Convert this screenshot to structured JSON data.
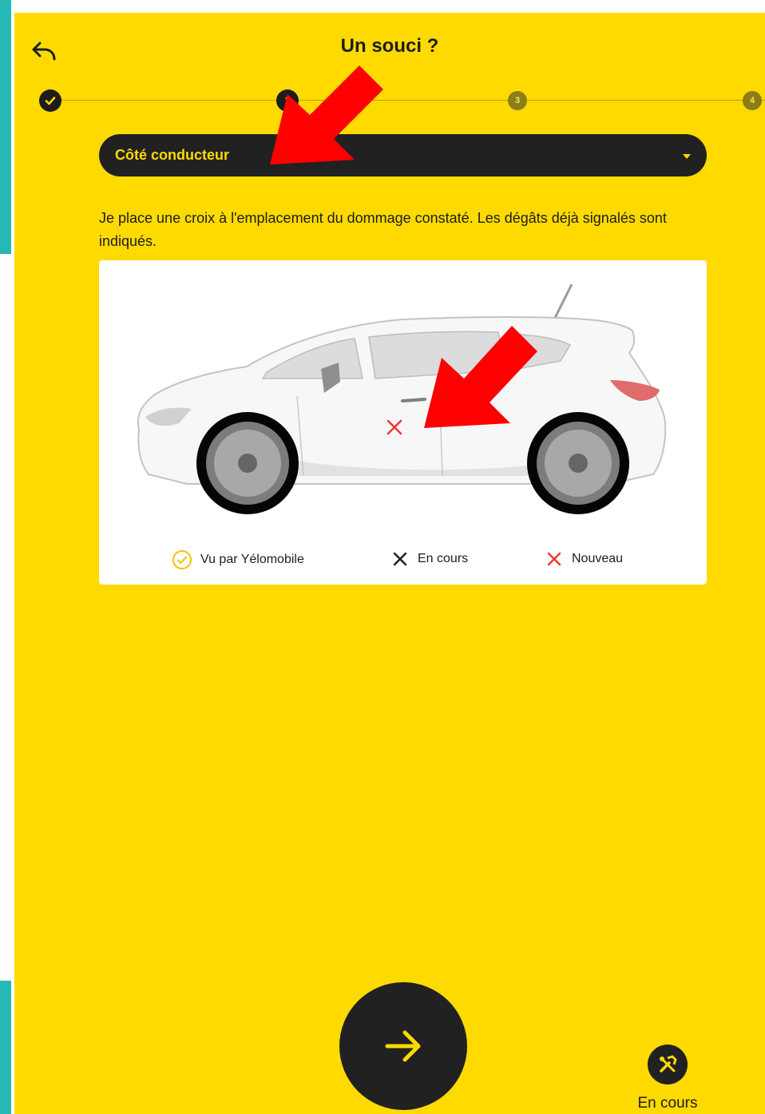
{
  "header": {
    "title": "Un souci ?"
  },
  "stepper": {
    "steps": [
      {
        "label": "",
        "state": "done"
      },
      {
        "label": "2",
        "state": "current"
      },
      {
        "label": "3",
        "state": "pending"
      },
      {
        "label": "4",
        "state": "pending"
      }
    ]
  },
  "side_select": {
    "selected": "Côté conducteur"
  },
  "instruction": "Je place une croix à l'emplacement du dommage constaté. Les dégâts déjà signalés sont indiqués.",
  "legend": {
    "seen": "Vu par Yélomobile",
    "in_progress": "En cours",
    "new": "Nouveau"
  },
  "status_button": {
    "label": "En cours"
  },
  "colors": {
    "background": "#ffda00",
    "dark": "#212121",
    "new_damage": "#e8392f",
    "annotation": "#ff0000",
    "side_edge": "#26b7b7"
  },
  "icons": {
    "back": "back-arrow-icon",
    "next": "arrow-right-icon",
    "status": "tools-icon",
    "seen": "check-circle-icon",
    "in_progress": "cross-icon",
    "new": "cross-icon"
  }
}
